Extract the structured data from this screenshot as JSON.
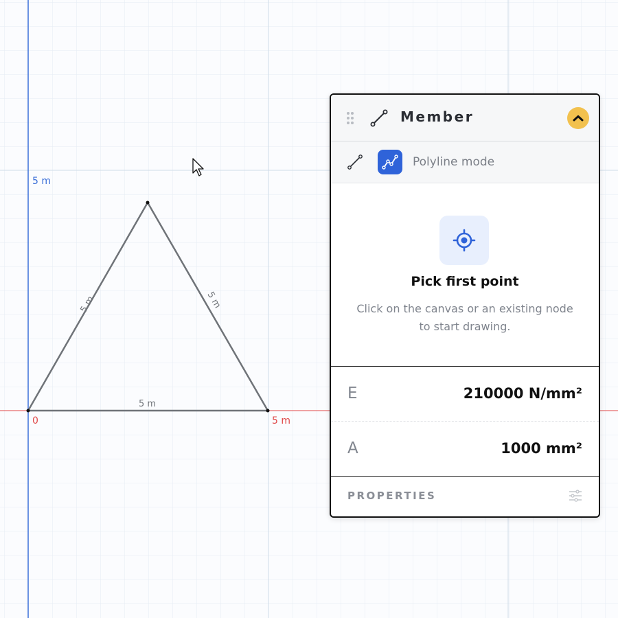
{
  "canvas": {
    "axis_y_label": "5 m",
    "origin_label": "0",
    "axis_x_label": "5 m",
    "members": [
      {
        "label": "5 m"
      },
      {
        "label": "5 m"
      },
      {
        "label": "5 m"
      }
    ],
    "colors": {
      "y_axis": "#3a6fd8",
      "x_axis": "#e04848",
      "member": "#6f7378"
    }
  },
  "panel": {
    "title": "Member",
    "mode_label": "Polyline mode",
    "pick_title": "Pick first point",
    "pick_desc_line1": "Click on the canvas or an existing node",
    "pick_desc_line2": "to start drawing.",
    "properties": [
      {
        "key": "E",
        "value": "210000 N/mm²"
      },
      {
        "key": "A",
        "value": "1000 mm²"
      }
    ],
    "footer_label": "PROPERTIES",
    "icons": {
      "drag": "drag-handle-icon",
      "member": "line-segment-icon",
      "collapse": "chevron-up-icon",
      "line_mode": "line-segment-icon",
      "polyline_mode": "polyline-icon",
      "target": "crosshair-target-icon",
      "settings": "sliders-icon"
    },
    "colors": {
      "accent": "#2f63d9",
      "collapse": "#f2c14e"
    }
  }
}
